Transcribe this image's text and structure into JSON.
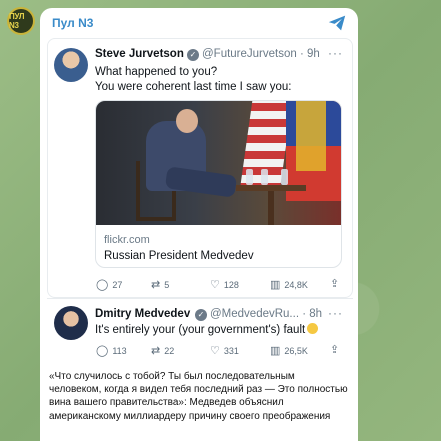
{
  "channel": {
    "name": "Пул N3",
    "avatar_text": "ПУЛ N3"
  },
  "tweet1": {
    "author_name": "Steve Jurvetson",
    "handle_time": "@FutureJurvetson · 9h",
    "line1": "What happened to you?",
    "line2": "You were coherent last time I saw you:",
    "link_domain": "flickr.com",
    "link_title": "Russian President Medvedev",
    "stats": {
      "replies": "27",
      "retweets": "5",
      "likes": "128",
      "views": "24,8K"
    }
  },
  "tweet2": {
    "author_name": "Dmitry Medvedev",
    "handle_time": "@MedvedevRu... · 8h",
    "text": "It's entirely your (your government's) fault",
    "stats": {
      "replies": "113",
      "retweets": "22",
      "likes": "331",
      "views": "26,5K"
    }
  },
  "message": {
    "text": "«Что случилось с тобой? Ты был последовательным человеком, когда я видел тебя последний раз — Это полностью вина вашего правительства»: Медведев объяснил американскому миллиардеру причину своего преображения"
  },
  "icons": {
    "share": "share-icon",
    "reply": "reply-icon",
    "retweet": "retweet-icon",
    "like": "heart-icon",
    "views": "views-icon",
    "upload": "upload-icon"
  },
  "colors": {
    "channel_name": "#3a8bc9",
    "wallpaper": "#8fb27a",
    "share_icon": "#3a8bc9"
  }
}
